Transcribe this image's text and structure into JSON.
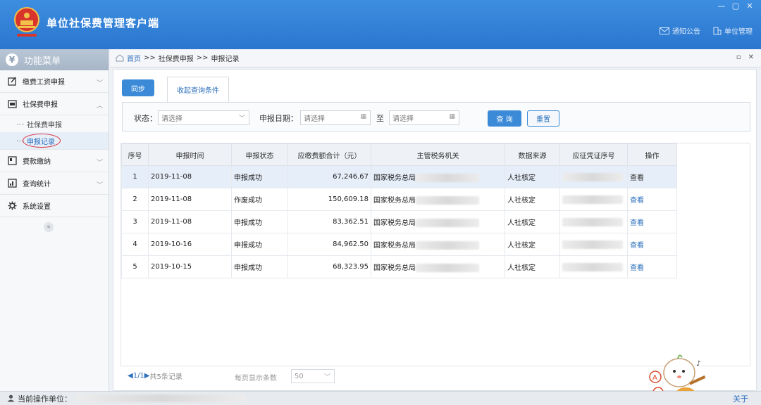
{
  "app": {
    "title": "单位社保费管理客户端",
    "window_controls": [
      "—",
      "▢",
      "✕"
    ],
    "top_links": [
      {
        "label": "通知公告",
        "icon": "mail-icon"
      },
      {
        "label": "单位管理",
        "icon": "building-icon"
      }
    ]
  },
  "sidebar": {
    "header": "功能菜单",
    "header_icon": "yen-icon",
    "items": [
      {
        "label": "缴费工资申报",
        "icon": "edit-icon"
      },
      {
        "label": "社保费申报",
        "icon": "calendar-icon",
        "expanded": true,
        "children": [
          {
            "label": "社保费申报",
            "active": false
          },
          {
            "label": "申报记录",
            "active": true
          }
        ]
      },
      {
        "label": "费款缴纳",
        "icon": "wallet-icon"
      },
      {
        "label": "查询统计",
        "icon": "chart-icon"
      },
      {
        "label": "系统设置",
        "icon": "gear-icon"
      }
    ],
    "collapse_symbol": "«"
  },
  "breadcrumb": {
    "home": "首页",
    "sep": ">>",
    "level1": "社保费申报",
    "level2": "申报记录",
    "tools": [
      "▫",
      "✕"
    ]
  },
  "toolbar": {
    "sync_label": "同步",
    "tab_label": "收起查询条件"
  },
  "filter": {
    "status_label": "状态：",
    "status_placeholder": "请选择",
    "date_label": "申报日期：",
    "date_from_placeholder": "请选择",
    "to_label": "至",
    "date_to_placeholder": "请选择",
    "query_label": "查 询",
    "reset_label": "重置"
  },
  "table": {
    "headers": [
      "序号",
      "申报时间",
      "申报状态",
      "应缴费额合计（元）",
      "主管税务机关",
      "数据来源",
      "应征凭证序号",
      "操作"
    ],
    "rows": [
      {
        "no": "1",
        "date": "2019-11-08",
        "status": "申报成功",
        "amount": "67,246.67",
        "authority": "国家税务总局",
        "source": "人社核定",
        "action": "查看",
        "selected": true
      },
      {
        "no": "2",
        "date": "2019-11-08",
        "status": "作废成功",
        "amount": "150,609.18",
        "authority": "国家税务总局",
        "source": "人社核定",
        "action": "查看"
      },
      {
        "no": "3",
        "date": "2019-11-08",
        "status": "申报成功",
        "amount": "83,362.51",
        "authority": "国家税务总局",
        "source": "人社核定",
        "action": "查看"
      },
      {
        "no": "4",
        "date": "2019-10-16",
        "status": "申报成功",
        "amount": "84,962.50",
        "authority": "国家税务总局",
        "source": "人社核定",
        "action": "查看"
      },
      {
        "no": "5",
        "date": "2019-10-15",
        "status": "申报成功",
        "amount": "68,323.95",
        "authority": "国家税务总局",
        "source": "人社核定",
        "action": "查看"
      }
    ]
  },
  "pager": {
    "prev": "◀",
    "page": "1/1",
    "next": "▶",
    "summary": "共5条记录",
    "page_size_label": "每页显示条数",
    "page_size": "50"
  },
  "status_bar": {
    "label": "当前操作单位：",
    "about": "关于"
  },
  "colors": {
    "header_blue": "#2a76cf",
    "accent_blue": "#3b8ad8",
    "link_blue": "#2b6fbd",
    "highlight_circle": "#d9333f"
  }
}
